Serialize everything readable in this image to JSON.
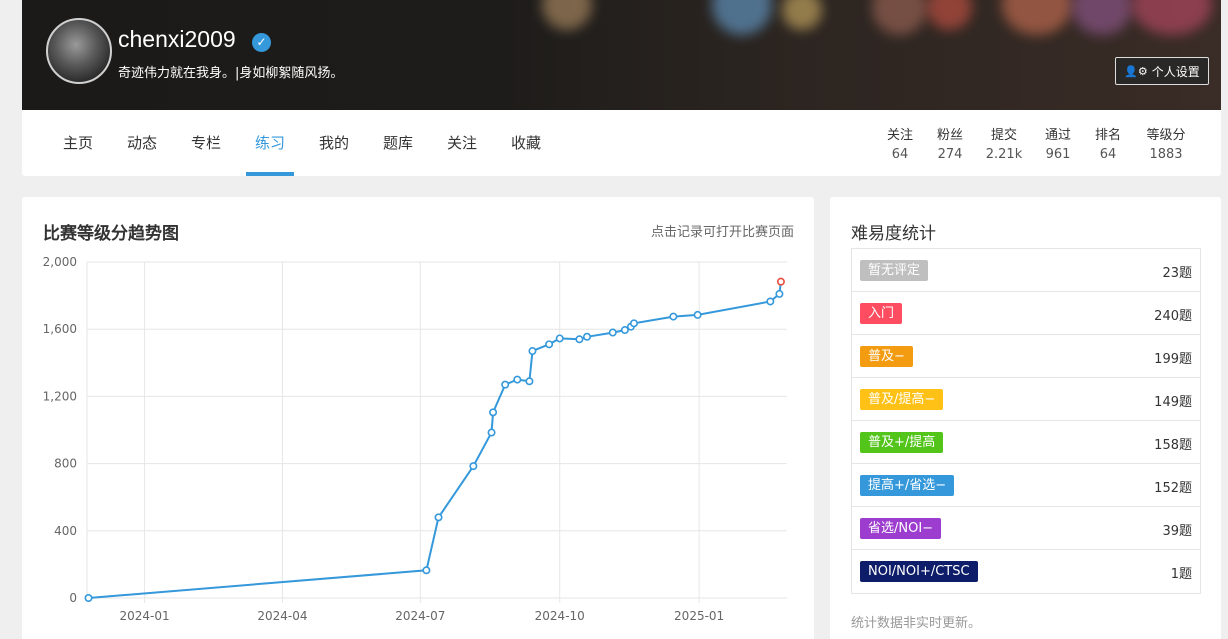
{
  "profile": {
    "username": "chenxi2009",
    "verified_icon": "check-badge-icon",
    "motto": "奇迹伟力就在我身。|身如柳絮随风扬。",
    "settings_label": "个人设置",
    "settings_icon": "user-gear-icon"
  },
  "nav": {
    "tabs": [
      "主页",
      "动态",
      "专栏",
      "练习",
      "我的",
      "题库",
      "关注",
      "收藏"
    ],
    "active_tab": "练习"
  },
  "stats": [
    {
      "label": "关注",
      "value": "64"
    },
    {
      "label": "粉丝",
      "value": "274"
    },
    {
      "label": "提交",
      "value": "2.21k"
    },
    {
      "label": "通过",
      "value": "961"
    },
    {
      "label": "排名",
      "value": "64"
    },
    {
      "label": "等级分",
      "value": "1883"
    }
  ],
  "chart": {
    "title": "比赛等级分趋势图",
    "hint": "点击记录可打开比赛页面"
  },
  "chart_data": {
    "type": "line",
    "title": "比赛等级分趋势图",
    "ylim": [
      0,
      2000
    ],
    "y_ticks": [
      "0",
      "400",
      "800",
      "1,200",
      "1,600",
      "2,000"
    ],
    "x_ticks": [
      "2024-01",
      "2024-04",
      "2024-07",
      "2024-10",
      "2025-01"
    ],
    "xlim": [
      "2023-11-24",
      "2025-02-28"
    ],
    "grid": true,
    "line_color": "#3498db",
    "last_point_color": "#e74c3c",
    "points": [
      {
        "x": "2023-11-25",
        "y": 0
      },
      {
        "x": "2024-07-05",
        "y": 165
      },
      {
        "x": "2024-07-13",
        "y": 480
      },
      {
        "x": "2024-08-05",
        "y": 785
      },
      {
        "x": "2024-08-17",
        "y": 985
      },
      {
        "x": "2024-08-18",
        "y": 1105
      },
      {
        "x": "2024-08-26",
        "y": 1270
      },
      {
        "x": "2024-09-03",
        "y": 1300
      },
      {
        "x": "2024-09-11",
        "y": 1290
      },
      {
        "x": "2024-09-13",
        "y": 1470
      },
      {
        "x": "2024-09-24",
        "y": 1510
      },
      {
        "x": "2024-10-01",
        "y": 1545
      },
      {
        "x": "2024-10-14",
        "y": 1540
      },
      {
        "x": "2024-10-19",
        "y": 1555
      },
      {
        "x": "2024-11-05",
        "y": 1580
      },
      {
        "x": "2024-11-13",
        "y": 1595
      },
      {
        "x": "2024-11-17",
        "y": 1615
      },
      {
        "x": "2024-11-19",
        "y": 1635
      },
      {
        "x": "2024-12-15",
        "y": 1675
      },
      {
        "x": "2024-12-31",
        "y": 1685
      },
      {
        "x": "2025-02-17",
        "y": 1765
      },
      {
        "x": "2025-02-23",
        "y": 1810
      },
      {
        "x": "2025-02-24",
        "y": 1883
      }
    ]
  },
  "difficulty": {
    "title": "难易度统计",
    "note": "统计数据非实时更新。",
    "items": [
      {
        "label": "暂无评定",
        "count": "23题",
        "color": "#bfbfbf"
      },
      {
        "label": "入门",
        "count": "240题",
        "color": "#fe4c61"
      },
      {
        "label": "普及−",
        "count": "199题",
        "color": "#f39c11"
      },
      {
        "label": "普及/提高−",
        "count": "149题",
        "color": "#ffc116"
      },
      {
        "label": "普及+/提高",
        "count": "158题",
        "color": "#52c41a"
      },
      {
        "label": "提高+/省选−",
        "count": "152题",
        "color": "#3498db"
      },
      {
        "label": "省选/NOI−",
        "count": "39题",
        "color": "#9d3dcf"
      },
      {
        "label": "NOI/NOI+/CTSC",
        "count": "1题",
        "color": "#0e1d69"
      }
    ]
  }
}
